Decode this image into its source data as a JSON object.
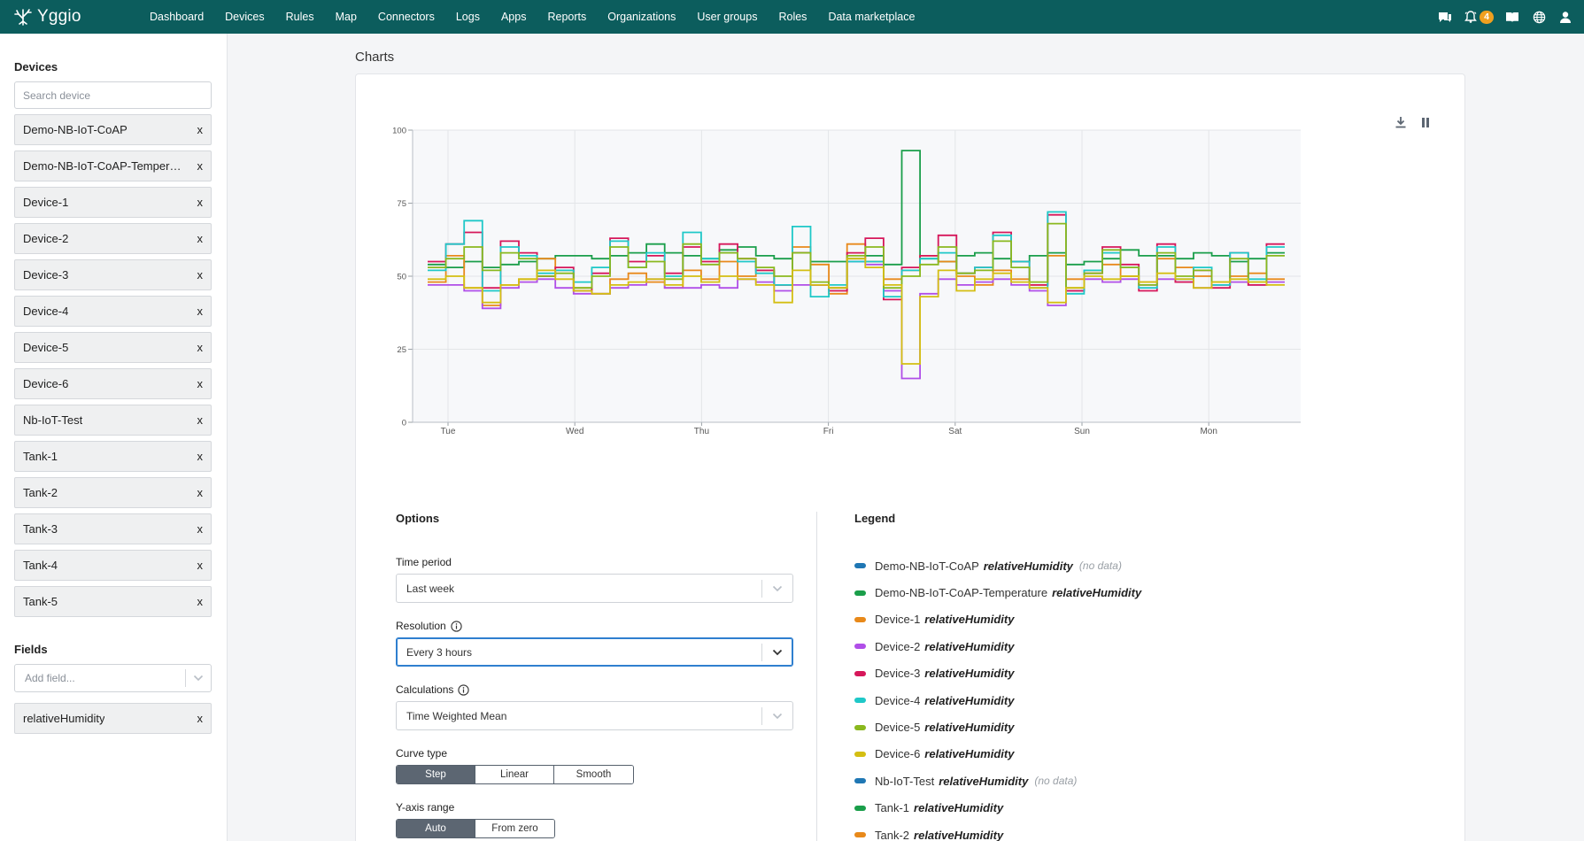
{
  "app": {
    "name": "Yggio"
  },
  "nav": {
    "links": [
      "Dashboard",
      "Devices",
      "Rules",
      "Map",
      "Connectors",
      "Logs",
      "Apps",
      "Reports",
      "Organizations",
      "User groups",
      "Roles",
      "Data marketplace"
    ],
    "notification_count": "4",
    "icons": [
      "message-icon",
      "bell-icon",
      "book-icon",
      "globe-icon",
      "user-icon"
    ]
  },
  "sidebar": {
    "devices_heading": "Devices",
    "search_placeholder": "Search device",
    "devices": [
      "Demo-NB-IoT-CoAP",
      "Demo-NB-IoT-CoAP-Temperature",
      "Device-1",
      "Device-2",
      "Device-3",
      "Device-4",
      "Device-5",
      "Device-6",
      "Nb-IoT-Test",
      "Tank-1",
      "Tank-2",
      "Tank-3",
      "Tank-4",
      "Tank-5"
    ],
    "remove_label": "x",
    "fields_heading": "Fields",
    "add_field_placeholder": "Add field...",
    "fields": [
      "relativeHumidity"
    ]
  },
  "main": {
    "title": "Charts"
  },
  "options": {
    "heading": "Options",
    "time_period": {
      "label": "Time period",
      "value": "Last week"
    },
    "resolution": {
      "label": "Resolution",
      "value": "Every 3 hours"
    },
    "calculations": {
      "label": "Calculations",
      "value": "Time Weighted Mean"
    },
    "curve_type": {
      "label": "Curve type",
      "options": [
        "Step",
        "Linear",
        "Smooth"
      ],
      "selected": "Step"
    },
    "y_axis_range": {
      "label": "Y-axis range",
      "options": [
        "Auto",
        "From zero"
      ],
      "selected": "Auto"
    }
  },
  "legend": {
    "heading": "Legend",
    "items": [
      {
        "device": "Demo-NB-IoT-CoAP",
        "field": "relativeHumidity",
        "note": "(no data)",
        "color": "#1f77b4"
      },
      {
        "device": "Demo-NB-IoT-CoAP-Temperature",
        "field": "relativeHumidity",
        "note": "",
        "color": "#1a9e4a"
      },
      {
        "device": "Device-1",
        "field": "relativeHumidity",
        "note": "",
        "color": "#e8891a"
      },
      {
        "device": "Device-2",
        "field": "relativeHumidity",
        "note": "",
        "color": "#b04ee8"
      },
      {
        "device": "Device-3",
        "field": "relativeHumidity",
        "note": "",
        "color": "#d6175a"
      },
      {
        "device": "Device-4",
        "field": "relativeHumidity",
        "note": "",
        "color": "#1fc8c8"
      },
      {
        "device": "Device-5",
        "field": "relativeHumidity",
        "note": "",
        "color": "#8ab81e"
      },
      {
        "device": "Device-6",
        "field": "relativeHumidity",
        "note": "",
        "color": "#d4be12"
      },
      {
        "device": "Nb-IoT-Test",
        "field": "relativeHumidity",
        "note": "(no data)",
        "color": "#1f77b4"
      },
      {
        "device": "Tank-1",
        "field": "relativeHumidity",
        "note": "",
        "color": "#1a9e4a"
      },
      {
        "device": "Tank-2",
        "field": "relativeHumidity",
        "note": "",
        "color": "#e8891a"
      }
    ]
  },
  "chart_data": {
    "type": "line",
    "curve": "step",
    "x_ticks": [
      "Tue",
      "Wed",
      "Thu",
      "Fri",
      "Sat",
      "Sun",
      "Mon"
    ],
    "ylim": [
      0,
      100
    ],
    "y_ticks": [
      0,
      25,
      50,
      75,
      100
    ],
    "grid": true,
    "series": [
      {
        "name": "Demo-NB-IoT-CoAP-Temperature relativeHumidity",
        "color": "#1a9e4a",
        "values": [
          54,
          53,
          55,
          53,
          54,
          55,
          56,
          57,
          57,
          56,
          57,
          58,
          61,
          58,
          57,
          56,
          59,
          60,
          57,
          56,
          58,
          55,
          55,
          56,
          57,
          54,
          93,
          56,
          55,
          57,
          58,
          56,
          55,
          57,
          58,
          54,
          55,
          56,
          59,
          57,
          57,
          56,
          58,
          57,
          55,
          56,
          58
        ]
      },
      {
        "name": "Device-1 relativeHumidity",
        "color": "#e8891a",
        "values": [
          48,
          57,
          46,
          40,
          47,
          49,
          56,
          52,
          46,
          44,
          49,
          51,
          48,
          46,
          52,
          49,
          55,
          50,
          52,
          47,
          60,
          54,
          44,
          61,
          55,
          49,
          52,
          57,
          55,
          50,
          47,
          52,
          49,
          47,
          57,
          49,
          52,
          54,
          50,
          48,
          56,
          53,
          50,
          47,
          50,
          51,
          49
        ]
      },
      {
        "name": "Device-2 relativeHumidity",
        "color": "#b04ee8",
        "values": [
          47,
          47,
          45,
          39,
          46,
          48,
          49,
          46,
          44,
          44,
          46,
          47,
          49,
          46,
          46,
          47,
          46,
          49,
          48,
          45,
          47,
          47,
          46,
          55,
          54,
          45,
          15,
          44,
          49,
          47,
          48,
          49,
          47,
          45,
          40,
          45,
          49,
          48,
          49,
          47,
          49,
          48,
          46,
          47,
          48,
          47,
          48
        ]
      },
      {
        "name": "Device-3 relativeHumidity",
        "color": "#d6175a",
        "values": [
          55,
          61,
          65,
          46,
          62,
          58,
          50,
          53,
          45,
          51,
          63,
          55,
          57,
          51,
          60,
          55,
          61,
          56,
          52,
          47,
          58,
          47,
          45,
          58,
          63,
          42,
          53,
          57,
          64,
          51,
          53,
          65,
          55,
          47,
          71,
          45,
          51,
          60,
          54,
          45,
          61,
          48,
          52,
          46,
          58,
          47,
          61
        ]
      },
      {
        "name": "Device-4 relativeHumidity",
        "color": "#1fc8c8",
        "values": [
          52,
          61,
          69,
          45,
          60,
          57,
          51,
          52,
          48,
          53,
          62,
          53,
          58,
          50,
          65,
          56,
          58,
          55,
          51,
          47,
          67,
          43,
          47,
          55,
          55,
          43,
          52,
          56,
          58,
          51,
          53,
          64,
          55,
          46,
          72,
          44,
          52,
          58,
          53,
          46,
          60,
          49,
          53,
          47,
          58,
          49,
          60
        ]
      },
      {
        "name": "Device-5 relativeHumidity",
        "color": "#8ab81e",
        "values": [
          53,
          56,
          60,
          52,
          58,
          56,
          50,
          51,
          46,
          50,
          60,
          53,
          55,
          49,
          61,
          54,
          58,
          56,
          53,
          50,
          58,
          48,
          46,
          57,
          60,
          46,
          50,
          54,
          60,
          51,
          52,
          62,
          53,
          48,
          68,
          46,
          51,
          59,
          53,
          47,
          58,
          50,
          52,
          48,
          56,
          48,
          57
        ]
      },
      {
        "name": "Device-6 relativeHumidity",
        "color": "#d4be12",
        "values": [
          49,
          50,
          46,
          41,
          47,
          49,
          52,
          49,
          45,
          44,
          47,
          48,
          49,
          47,
          50,
          48,
          50,
          49,
          47,
          41,
          52,
          47,
          46,
          56,
          53,
          47,
          20,
          43,
          52,
          45,
          49,
          51,
          48,
          46,
          41,
          46,
          50,
          49,
          50,
          48,
          51,
          49,
          46,
          48,
          49,
          48,
          47
        ]
      }
    ]
  }
}
